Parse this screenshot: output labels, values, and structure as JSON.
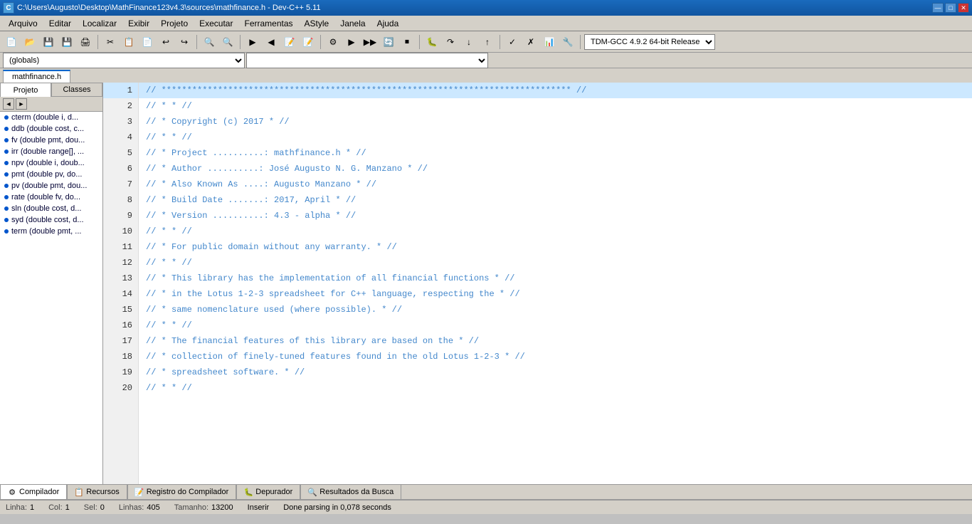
{
  "titleBar": {
    "title": "C:\\Users\\Augusto\\Desktop\\MathFinance123v4.3\\sources\\mathfinance.h - Dev-C++ 5.11",
    "icon": "C",
    "buttons": {
      "minimize": "—",
      "maximize": "□",
      "close": "✕"
    }
  },
  "menuBar": {
    "items": [
      "Arquivo",
      "Editar",
      "Localizar",
      "Exibir",
      "Projeto",
      "Executar",
      "Ferramentas",
      "AStyle",
      "Janela",
      "Ajuda"
    ]
  },
  "toolbar1": {
    "buttons": [
      "📄",
      "📂",
      "💾",
      "🖨",
      "✂",
      "📋",
      "📄",
      "↩",
      "↪",
      "🔍",
      "🔍",
      "🔲",
      "🔲",
      "🔲",
      "🔲",
      "▶",
      "⏹",
      "▶",
      "🔲",
      "🔲",
      "🔲",
      "🔲",
      "🔲",
      "✓",
      "✗",
      "📊",
      "🔧"
    ],
    "compilerCombo": "TDM-GCC 4.9.2 64-bit Release"
  },
  "toolbar2": {
    "combo1": "(globals)",
    "combo2": ""
  },
  "fileTabs": {
    "tabs": [
      "mathfinance.h"
    ]
  },
  "sidebar": {
    "tabs": [
      "Projeto",
      "Classes"
    ],
    "navButtons": [
      "◄",
      "►"
    ],
    "items": [
      "cterm (double i, d...",
      "ddb (double cost, c...",
      "fv (double pmt, dou...",
      "irr (double range[], ...",
      "npv (double i, doub...",
      "pmt (double pv, do...",
      "pv (double pmt, dou...",
      "rate (double fv, do...",
      "sln (double cost, d...",
      "syd (double cost, d...",
      "term (double pmt, ..."
    ]
  },
  "codeEditor": {
    "filename": "mathfinance.h",
    "lines": [
      {
        "num": 1,
        "text": "// ********************************************************************************  //",
        "selected": true
      },
      {
        "num": 2,
        "text": "// *                                                                            * //",
        "selected": false
      },
      {
        "num": 3,
        "text": "// *                                          Copyright (c) 2017               * //",
        "selected": false
      },
      {
        "num": 4,
        "text": "// *                                                                            * //",
        "selected": false
      },
      {
        "num": 5,
        "text": "// * Project ..........: mathfinance.h                                          * //",
        "selected": false
      },
      {
        "num": 6,
        "text": "// * Author ..........: José Augusto N. G. Manzano                              * //",
        "selected": false
      },
      {
        "num": 7,
        "text": "// * Also Known As ....: Augusto Manzano                                        * //",
        "selected": false
      },
      {
        "num": 8,
        "text": "// * Build Date .......: 2017, April                                            * //",
        "selected": false
      },
      {
        "num": 9,
        "text": "// * Version ..........: 4.3 - alpha                                            * //",
        "selected": false
      },
      {
        "num": 10,
        "text": "// *                                                                            * //",
        "selected": false
      },
      {
        "num": 11,
        "text": "// * For public domain without any warranty.                                    * //",
        "selected": false
      },
      {
        "num": 12,
        "text": "// *                                                                            * //",
        "selected": false
      },
      {
        "num": 13,
        "text": "// * This library has the implementation of all financial functions             * //",
        "selected": false
      },
      {
        "num": 14,
        "text": "// * in the Lotus 1-2-3 spreadsheet for C++ language, respecting the           * //",
        "selected": false
      },
      {
        "num": 15,
        "text": "// * same nomenclature used (where possible).                                   * //",
        "selected": false
      },
      {
        "num": 16,
        "text": "// *                                                                            * //",
        "selected": false
      },
      {
        "num": 17,
        "text": "// * The financial features of this library are based on the                    * //",
        "selected": false
      },
      {
        "num": 18,
        "text": "// * collection of finely-tuned features found in the old Lotus 1-2-3          * //",
        "selected": false
      },
      {
        "num": 19,
        "text": "// * spreadsheet software.                                                      * //",
        "selected": false
      },
      {
        "num": 20,
        "text": "// *                                                                            * //",
        "selected": false
      }
    ]
  },
  "bottomTabs": {
    "tabs": [
      {
        "label": "Compilador",
        "icon": "⚙"
      },
      {
        "label": "Recursos",
        "icon": "📋"
      },
      {
        "label": "Registro do Compilador",
        "icon": "📝"
      },
      {
        "label": "Depurador",
        "icon": "🐛"
      },
      {
        "label": "Resultados da Busca",
        "icon": "🔍"
      }
    ]
  },
  "statusBar": {
    "linha": {
      "label": "Linha:",
      "value": "1"
    },
    "col": {
      "label": "Col:",
      "value": "1"
    },
    "sel": {
      "label": "Sel:",
      "value": "0"
    },
    "linhas": {
      "label": "Linhas:",
      "value": "405"
    },
    "tamanho": {
      "label": "Tamanho:",
      "value": "13200"
    },
    "inserir": {
      "label": "",
      "value": "Inserir"
    },
    "done": {
      "label": "",
      "value": "Done parsing in 0,078 seconds"
    }
  }
}
